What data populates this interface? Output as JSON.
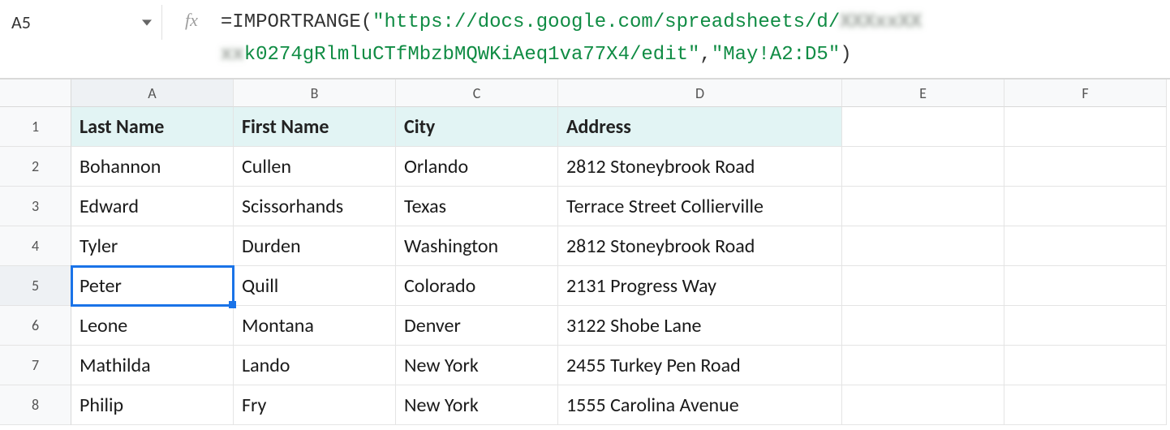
{
  "nameBox": "A5",
  "formula": {
    "prefix": "=IMPORTRANGE",
    "open": "(",
    "str1a": "\"https://docs.google.com/spreadsheets/d/",
    "blur1": "XXXxxXX",
    "blur2": "xx",
    "str1b": "k0274gRlmluCTfMbzbMQWKiAeq1va77X4/edit\"",
    "comma": ",",
    "str2": "\"May!A2:D5\"",
    "close": ")"
  },
  "columns": [
    "A",
    "B",
    "C",
    "D",
    "E",
    "F"
  ],
  "rowNumbers": [
    "1",
    "2",
    "3",
    "4",
    "5",
    "6",
    "7",
    "8"
  ],
  "selected": {
    "row": 5,
    "col": 1
  },
  "headers": [
    "Last Name",
    "First Name",
    "City",
    "Address"
  ],
  "rows": [
    [
      "Bohannon",
      "Cullen",
      "Orlando",
      "2812 Stoneybrook Road"
    ],
    [
      "Edward",
      "Scissorhands",
      "Texas",
      "Terrace Street Collierville"
    ],
    [
      "Tyler",
      "Durden",
      "Washington",
      "2812 Stoneybrook Road"
    ],
    [
      "Peter",
      "Quill",
      "Colorado",
      "2131 Progress Way"
    ],
    [
      "Leone",
      "Montana",
      "Denver",
      "3122 Shobe Lane"
    ],
    [
      "Mathilda",
      "Lando",
      "New York",
      "2455 Turkey Pen Road"
    ],
    [
      "Philip",
      "Fry",
      "New York",
      "1555 Carolina Avenue"
    ]
  ]
}
